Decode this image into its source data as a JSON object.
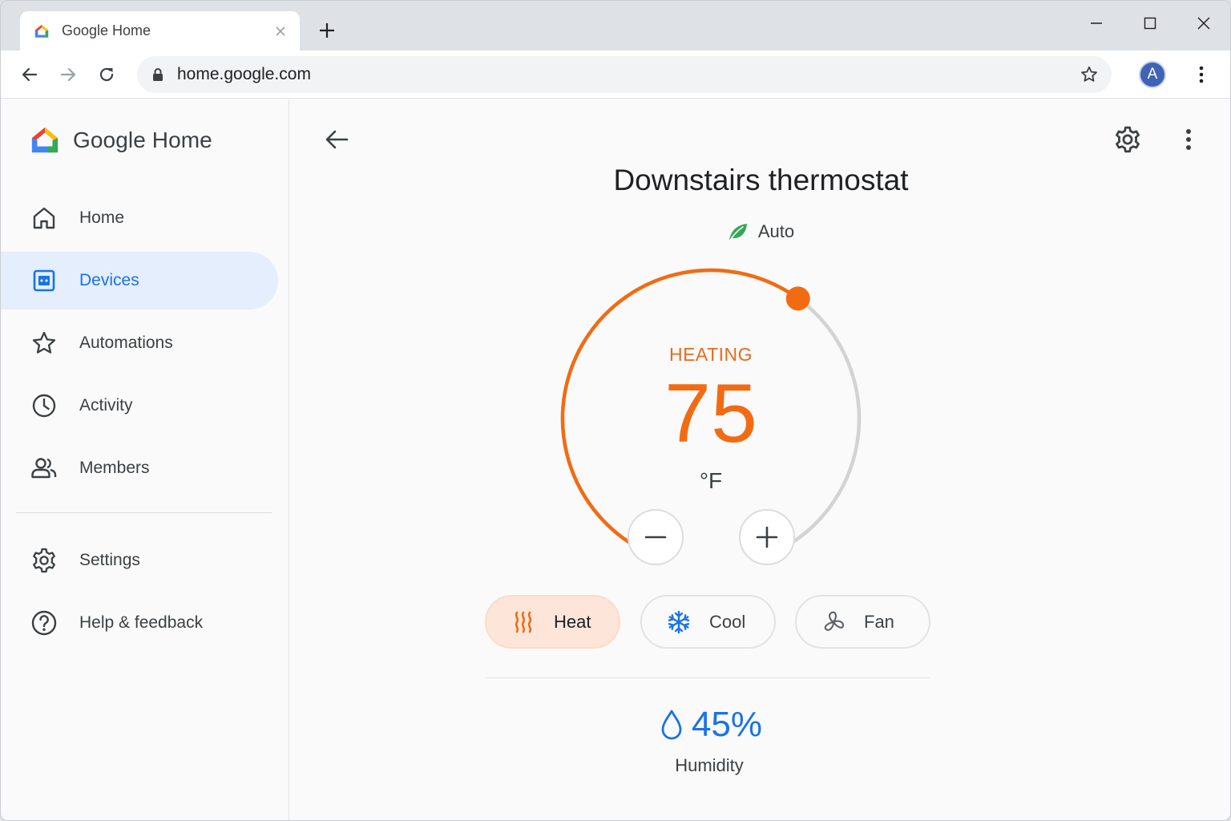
{
  "browser": {
    "tab_title": "Google Home",
    "url": "home.google.com",
    "profile_initial": "A"
  },
  "sidebar": {
    "brand": "Google Home",
    "items": [
      {
        "label": "Home",
        "icon": "home-icon"
      },
      {
        "label": "Devices",
        "icon": "devices-icon",
        "active": true
      },
      {
        "label": "Automations",
        "icon": "star-icon"
      },
      {
        "label": "Activity",
        "icon": "clock-icon"
      },
      {
        "label": "Members",
        "icon": "members-icon"
      }
    ],
    "secondary": [
      {
        "label": "Settings",
        "icon": "gear-icon"
      },
      {
        "label": "Help & feedback",
        "icon": "help-icon"
      }
    ]
  },
  "device": {
    "title": "Downstairs thermostat",
    "mode": "Auto",
    "status": "HEATING",
    "setpoint": "75",
    "unit": "°F",
    "dial_fraction": 0.62,
    "modes": [
      {
        "label": "Heat",
        "icon": "heat-icon",
        "selected": true
      },
      {
        "label": "Cool",
        "icon": "snowflake-icon"
      },
      {
        "label": "Fan",
        "icon": "fan-icon"
      }
    ],
    "humidity_value": "45%",
    "humidity_label": "Humidity"
  },
  "colors": {
    "accent_orange": "#f26b12",
    "accent_blue": "#1a73e8",
    "active_nav_bg": "#e4eefc",
    "heat_chip_bg": "#fde6d9",
    "leaf_green": "#34a853"
  }
}
